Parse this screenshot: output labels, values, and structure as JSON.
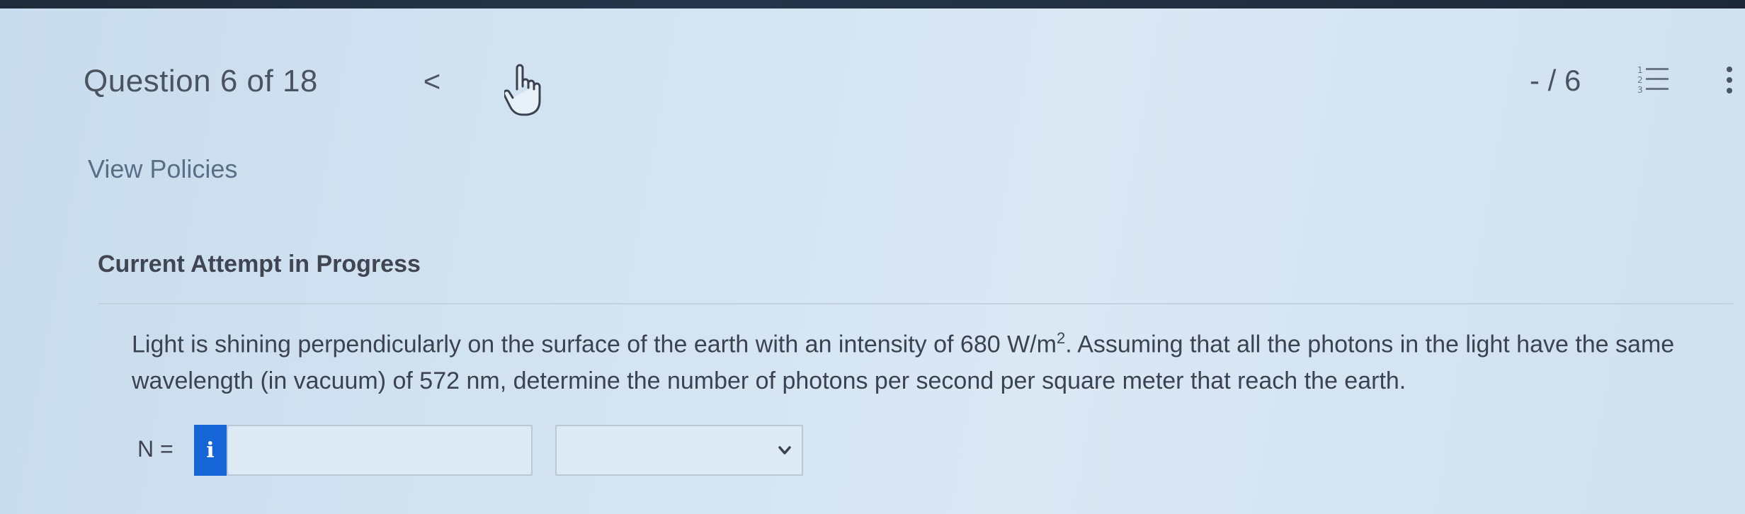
{
  "header": {
    "question_label": "Question 6 of 18",
    "prev_label": "<",
    "score": "- / 6"
  },
  "icons": {
    "prev": "chevron-left-icon",
    "pointer": "hand-pointer-icon",
    "list": "numbered-list-icon",
    "more": "more-vertical-icon",
    "info": "info-icon",
    "dropdown": "chevron-down-icon"
  },
  "links": {
    "view_policies": "View Policies"
  },
  "attempt": {
    "heading": "Current Attempt in Progress"
  },
  "question": {
    "text_before_sup": "Light is shining perpendicularly on the surface of the earth with an intensity of 680 W/m",
    "superscript": "2",
    "text_after_sup": ". Assuming that all the photons in the light have the same wavelength (in vacuum) of 572 nm, determine the number of photons per second per square meter that reach the earth."
  },
  "answer": {
    "label": "N =",
    "info_glyph": "i",
    "input_value": "",
    "unit_value": ""
  },
  "colors": {
    "accent": "#1565d6",
    "background": "#d3e3f1",
    "top_bar": "#1e2b3a",
    "text": "#3b4250",
    "link": "#5b6e86"
  }
}
